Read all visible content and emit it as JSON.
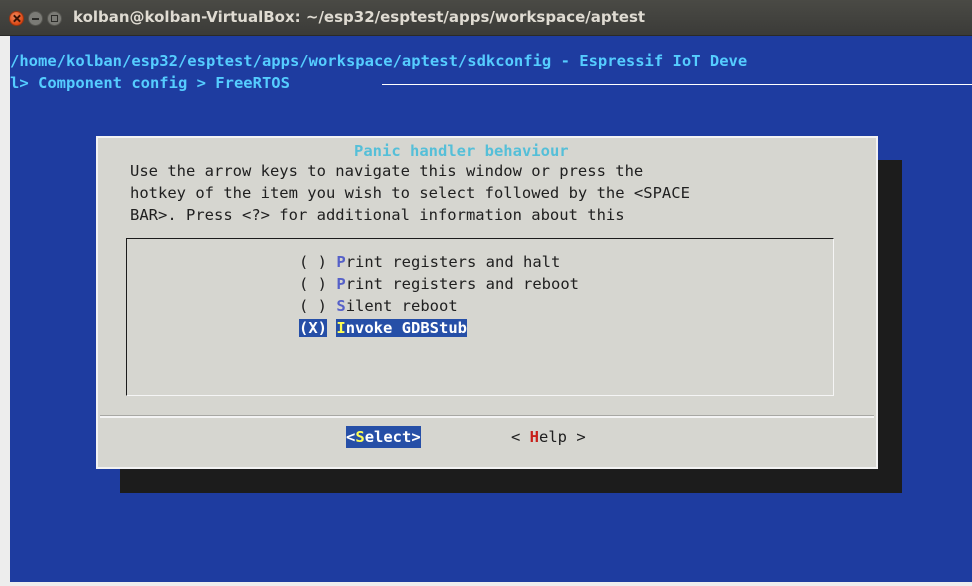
{
  "window": {
    "title": "kolban@kolban-VirtualBox: ~/esp32/esptest/apps/workspace/aptest"
  },
  "terminal": {
    "path_line": " /home/kolban/esp32/esptest/apps/workspace/aptest/sdkconfig - Espressif IoT Deve",
    "breadcrumb_line": "l> Component config > FreeRTOS"
  },
  "dialog": {
    "title": "Panic handler behaviour",
    "help_lines": [
      "Use the arrow keys to navigate this window or press the",
      "hotkey of the item you wish to select followed by the <SPACE",
      "BAR>. Press <?> for additional information about this"
    ],
    "options": [
      {
        "marker": "( )",
        "hotkey": "P",
        "rest": "rint registers and halt",
        "selected": false
      },
      {
        "marker": "( )",
        "hotkey": "P",
        "rest": "rint registers and reboot",
        "selected": false
      },
      {
        "marker": "( )",
        "hotkey": "S",
        "rest": "ilent reboot",
        "selected": false
      },
      {
        "marker": "(X)",
        "hotkey": "I",
        "rest": "nvoke GDBStub",
        "selected": true
      }
    ],
    "buttons": {
      "select": {
        "left": "<",
        "hotkey": "S",
        "rest": "elect>"
      },
      "help": {
        "left": "< ",
        "hotkey": "H",
        "rest": "elp >"
      }
    }
  },
  "colors": {
    "terminal_bg": "#1e3ca0",
    "dialog_bg": "#d6d6d0",
    "highlight": "#264fa7",
    "hotkey_selected": "#ffff55",
    "hotkey_help": "#c8201a",
    "title_text": "#55bfd8"
  }
}
